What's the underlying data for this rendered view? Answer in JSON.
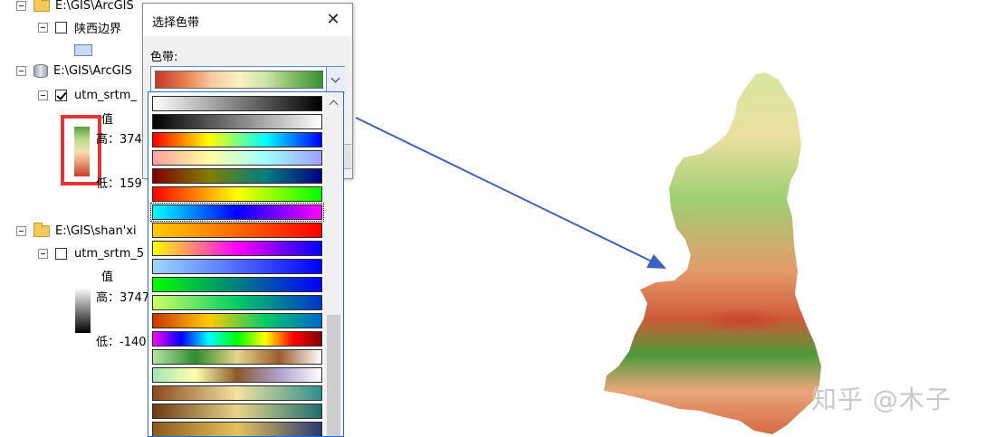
{
  "toc": {
    "group1": {
      "path": "E:\\GIS\\ArcGIS",
      "layer": "陕西边界"
    },
    "group2": {
      "path": "E:\\GIS\\ArcGIS",
      "layer": "utm_srtm_",
      "legend_heading": "值",
      "legend_high": "高：374",
      "legend_low": "低：159",
      "ramp_colors": [
        "#5aa13e",
        "#b9d88a",
        "#f4e3b2",
        "#e4936b",
        "#c3412e"
      ]
    },
    "group3": {
      "path": "E:\\GIS\\shan'xi",
      "layer": "utm_srtm_5",
      "legend_heading": "值",
      "legend_high": "高：3747",
      "legend_low": "低：-140",
      "ramp_colors": [
        "#ffffff",
        "#000000"
      ]
    }
  },
  "dialog": {
    "title": "选择色带",
    "close_glyph": "✕",
    "field_label": "色带:",
    "selected_ramp_colors": [
      "#c63a2a",
      "#e67a4c",
      "#f6c9a0",
      "#f8f3c5",
      "#c9e2a4",
      "#7bb960",
      "#3a8e3a"
    ]
  },
  "color_ramps": [
    [
      "#ffffff",
      "#000000"
    ],
    [
      "#000000",
      "#ffffff"
    ],
    [
      "#ff0000",
      "#ffff00",
      "#00ffff",
      "#0000ff"
    ],
    [
      "#ff9f9f",
      "#ffff9f",
      "#9fffff",
      "#9f9fff"
    ],
    [
      "#800000",
      "#808000",
      "#008080",
      "#000080"
    ],
    [
      "#ff0000",
      "#ffff00",
      "#00ff00"
    ],
    [
      "#00ffff",
      "#0000ff",
      "#ff00ff"
    ],
    [
      "#ffcc00",
      "#ff0000"
    ],
    [
      "#ffff00",
      "#ff00ff",
      "#0000ff"
    ],
    [
      "#9fd7ff",
      "#0000ff"
    ],
    [
      "#00ff00",
      "#0000ff"
    ],
    [
      "#ccff66",
      "#00cc66",
      "#0033cc"
    ],
    [
      "#cc3300",
      "#ffcc00",
      "#00cc66",
      "#0066cc"
    ],
    [
      "#ff00ff",
      "#0000ff",
      "#00ffff",
      "#00ff00",
      "#ffff00",
      "#ff0000",
      "#800000"
    ],
    [
      "#b7e4a6",
      "#2e8b2e",
      "#e6d58a",
      "#9a5d2e",
      "#ffffff"
    ],
    [
      "#9fe6b6",
      "#ffffb0",
      "#8a5a2a",
      "#b0a0d0",
      "#ffffff"
    ],
    [
      "#8b4a1e",
      "#f3e2a0",
      "#2f8f8f"
    ],
    [
      "#6b3a16",
      "#e8d58a",
      "#1f6f6f"
    ],
    [
      "#8a5a1a",
      "#e5c35a",
      "#2a3a70"
    ]
  ],
  "watermark": "知乎 @木子"
}
